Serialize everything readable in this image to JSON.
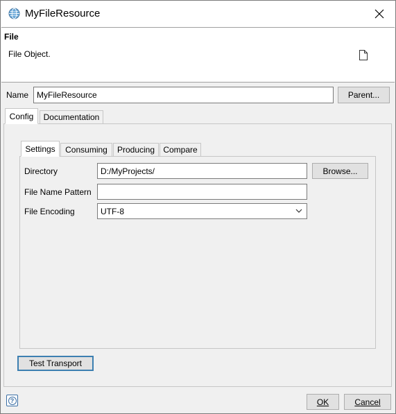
{
  "window": {
    "title": "MyFileResource"
  },
  "header": {
    "title": "File",
    "description": "File Object."
  },
  "name_row": {
    "label": "Name",
    "value": "MyFileResource",
    "parent_button": "Parent..."
  },
  "outer_tabs": [
    {
      "label": "Config",
      "active": true
    },
    {
      "label": "Documentation",
      "active": false
    }
  ],
  "inner_tabs": [
    {
      "label": "Settings",
      "active": true
    },
    {
      "label": "Consuming",
      "active": false
    },
    {
      "label": "Producing",
      "active": false
    },
    {
      "label": "Compare",
      "active": false
    }
  ],
  "settings": {
    "directory_label": "Directory",
    "directory_value": "D:/MyProjects/",
    "browse_button": "Browse...",
    "pattern_label": "File Name Pattern",
    "pattern_value": "",
    "encoding_label": "File Encoding",
    "encoding_value": "UTF-8"
  },
  "test_transport_button": "Test Transport",
  "footer": {
    "ok_button": "OK",
    "cancel_button": "Cancel"
  },
  "icons": {
    "app": "globe-icon",
    "close": "close-icon",
    "file": "file-icon",
    "help": "help-icon",
    "dropdown": "chevron-down-icon"
  }
}
